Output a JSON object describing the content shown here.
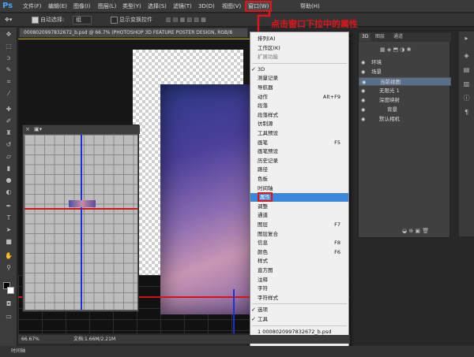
{
  "app": {
    "logo": "Ps"
  },
  "menubar": {
    "items": [
      "文件(F)",
      "编辑(E)",
      "图像(I)",
      "图层(L)",
      "类型(Y)",
      "选择(S)",
      "滤镜(T)",
      "3D(D)",
      "视图(V)",
      "窗口(W)",
      "帮助(H)"
    ]
  },
  "options": {
    "auto_select_label": "自动选择:",
    "auto_select_value": "组",
    "show_transform": "显示变换控件"
  },
  "document": {
    "tab_title": "0008020997832672_b.psd @ 66.7% (PHOTOSHOP 3D FEATURE POSTER DESIGN, RGB/8"
  },
  "annotation": {
    "text": "点击窗口下拉中的属性",
    "color": "#e2131b"
  },
  "dropdown": {
    "items": [
      {
        "label": "排列(A)",
        "shortcut": "",
        "check": false,
        "state": "normal"
      },
      {
        "label": "工作区(K)",
        "shortcut": "",
        "check": false,
        "state": "normal"
      },
      {
        "label": "扩展功能",
        "shortcut": "",
        "check": false,
        "state": "gray"
      },
      {
        "label": "3D",
        "shortcut": "",
        "check": true,
        "state": "normal"
      },
      {
        "label": "测量记录",
        "shortcut": "",
        "check": false,
        "state": "normal"
      },
      {
        "label": "导航器",
        "shortcut": "",
        "check": false,
        "state": "normal"
      },
      {
        "label": "动作",
        "shortcut": "Alt+F9",
        "check": false,
        "state": "normal"
      },
      {
        "label": "段落",
        "shortcut": "",
        "check": false,
        "state": "normal"
      },
      {
        "label": "段落样式",
        "shortcut": "",
        "check": false,
        "state": "normal"
      },
      {
        "label": "仿制源",
        "shortcut": "",
        "check": false,
        "state": "normal"
      },
      {
        "label": "工具预设",
        "shortcut": "",
        "check": false,
        "state": "normal"
      },
      {
        "label": "画笔",
        "shortcut": "F5",
        "check": false,
        "state": "normal"
      },
      {
        "label": "画笔预设",
        "shortcut": "",
        "check": false,
        "state": "normal"
      },
      {
        "label": "历史记录",
        "shortcut": "",
        "check": false,
        "state": "normal"
      },
      {
        "label": "路径",
        "shortcut": "",
        "check": false,
        "state": "normal"
      },
      {
        "label": "色板",
        "shortcut": "",
        "check": false,
        "state": "normal"
      },
      {
        "label": "时间轴",
        "shortcut": "",
        "check": false,
        "state": "normal"
      },
      {
        "label": "属性",
        "shortcut": "",
        "check": false,
        "state": "highlight"
      },
      {
        "label": "调整",
        "shortcut": "",
        "check": false,
        "state": "normal"
      },
      {
        "label": "通道",
        "shortcut": "",
        "check": false,
        "state": "normal"
      },
      {
        "label": "图层",
        "shortcut": "F7",
        "check": false,
        "state": "normal"
      },
      {
        "label": "图层复合",
        "shortcut": "",
        "check": false,
        "state": "normal"
      },
      {
        "label": "信息",
        "shortcut": "F8",
        "check": false,
        "state": "normal"
      },
      {
        "label": "颜色",
        "shortcut": "F6",
        "check": false,
        "state": "normal"
      },
      {
        "label": "样式",
        "shortcut": "",
        "check": false,
        "state": "normal"
      },
      {
        "label": "直方图",
        "shortcut": "",
        "check": false,
        "state": "normal"
      },
      {
        "label": "注释",
        "shortcut": "",
        "check": false,
        "state": "normal"
      },
      {
        "label": "字符",
        "shortcut": "",
        "check": false,
        "state": "normal"
      },
      {
        "label": "字符样式",
        "shortcut": "",
        "check": false,
        "state": "normal"
      },
      {
        "label": "选项",
        "shortcut": "",
        "check": true,
        "state": "normal"
      },
      {
        "label": "工具",
        "shortcut": "",
        "check": true,
        "state": "normal"
      },
      {
        "label": "1 0008020997832672_b.psd",
        "shortcut": "",
        "check": false,
        "state": "normal"
      },
      {
        "label": "2 0008020997832672_b.jpg",
        "shortcut": "",
        "check": true,
        "state": "normal"
      }
    ]
  },
  "layers_panel": {
    "tabs": [
      "3D",
      "图层",
      "通道"
    ],
    "rows": [
      {
        "label": "环境",
        "indent": 0,
        "selected": false
      },
      {
        "label": "场景",
        "indent": 0,
        "selected": false
      },
      {
        "label": "当前视图",
        "indent": 1,
        "selected": true
      },
      {
        "label": "无限光 1",
        "indent": 1,
        "selected": false
      },
      {
        "label": "深度映射",
        "indent": 1,
        "selected": false
      },
      {
        "label": "背景",
        "indent": 2,
        "selected": false
      },
      {
        "label": "默认相机",
        "indent": 1,
        "selected": false
      }
    ]
  },
  "status": {
    "zoom": "66.67%",
    "doc_info": "文档:1.66M/2.21M"
  },
  "timeline": {
    "label": "时间轴"
  }
}
